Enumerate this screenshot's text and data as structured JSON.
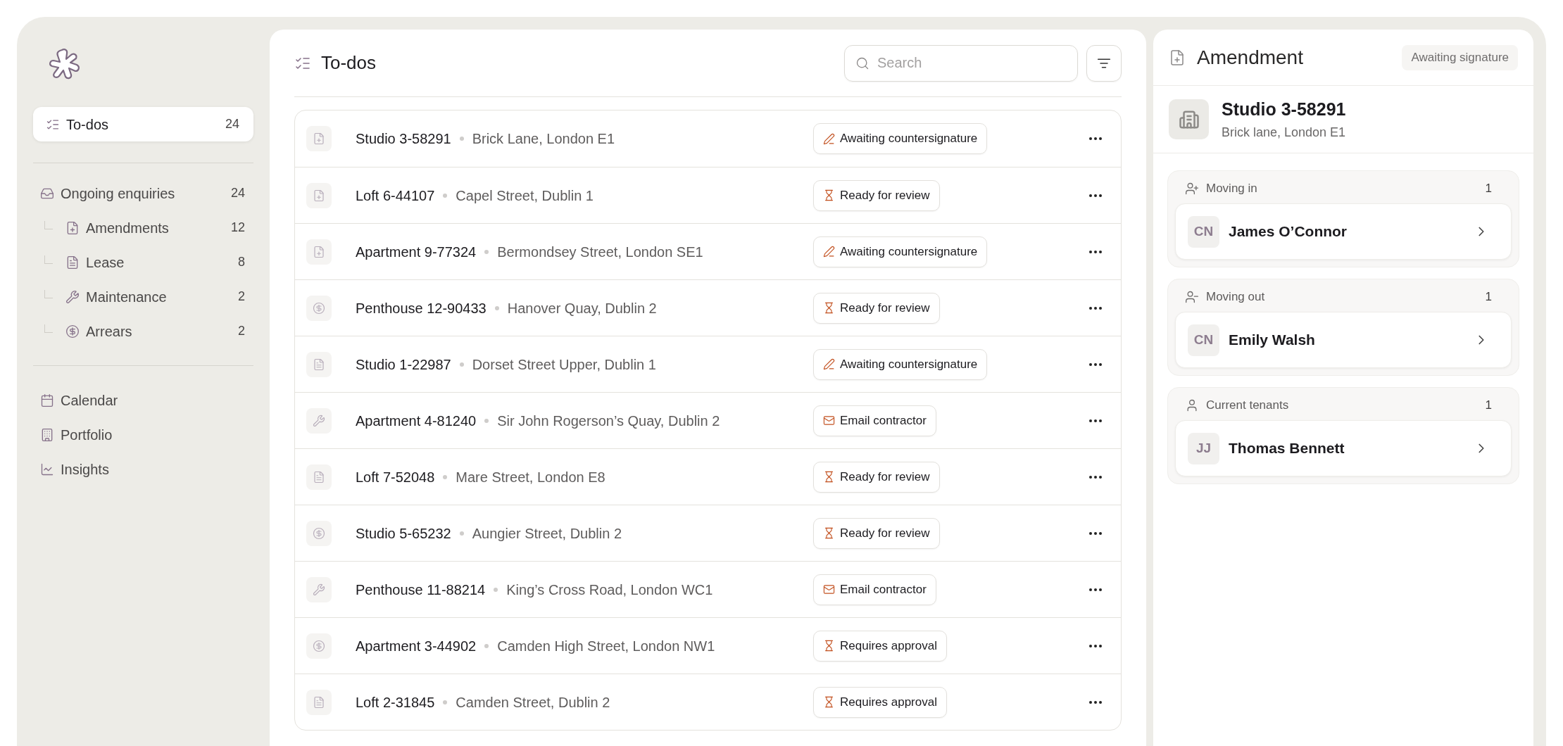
{
  "sidebar": {
    "items": [
      {
        "kind": "todos",
        "label": "To-dos",
        "count": "24",
        "selected": true
      },
      {
        "kind": "enquiries",
        "label": "Ongoing enquiries",
        "count": "24",
        "selected": false,
        "children": [
          {
            "kind": "amendment",
            "label": "Amendments",
            "count": "12",
            "selected": false
          },
          {
            "kind": "lease",
            "label": "Lease",
            "count": "8",
            "selected": false
          },
          {
            "kind": "maintenance",
            "label": "Maintenance",
            "count": "2",
            "selected": false
          },
          {
            "kind": "arrears",
            "label": "Arrears",
            "count": "2",
            "selected": false
          }
        ]
      },
      {
        "kind": "calendar",
        "label": "Calendar",
        "selected": false
      },
      {
        "kind": "portfolio",
        "label": "Portfolio",
        "selected": false
      },
      {
        "kind": "insights",
        "label": "Insights",
        "selected": false
      }
    ]
  },
  "main": {
    "title": "To-dos",
    "search": {
      "placeholder": "Search"
    },
    "rows": [
      {
        "kind": "amendment",
        "name": "Studio 3-58291",
        "address": "Brick Lane, London E1",
        "status": {
          "kind": "sign",
          "label": "Awaiting countersignature"
        }
      },
      {
        "kind": "amendment",
        "name": "Loft 6-44107",
        "address": "Capel Street, Dublin 1",
        "status": {
          "kind": "wait",
          "label": "Ready for review"
        }
      },
      {
        "kind": "amendment",
        "name": "Apartment 9-77324",
        "address": "Bermondsey Street, London SE1",
        "status": {
          "kind": "sign",
          "label": "Awaiting countersignature"
        }
      },
      {
        "kind": "arrears",
        "name": "Penthouse 12-90433",
        "address": "Hanover Quay, Dublin 2",
        "status": {
          "kind": "wait",
          "label": "Ready for review"
        }
      },
      {
        "kind": "lease",
        "name": "Studio 1-22987",
        "address": "Dorset Street Upper, Dublin 1",
        "status": {
          "kind": "sign",
          "label": "Awaiting countersignature"
        }
      },
      {
        "kind": "maintenance",
        "name": "Apartment 4-81240",
        "address": "Sir John Rogerson’s Quay, Dublin 2",
        "status": {
          "kind": "mail",
          "label": "Email contractor"
        }
      },
      {
        "kind": "lease",
        "name": "Loft 7-52048",
        "address": "Mare Street, London E8",
        "status": {
          "kind": "wait",
          "label": "Ready for review"
        }
      },
      {
        "kind": "arrears",
        "name": "Studio 5-65232",
        "address": "Aungier Street, Dublin 2",
        "status": {
          "kind": "wait",
          "label": "Ready for review"
        }
      },
      {
        "kind": "maintenance",
        "name": "Penthouse 11-88214",
        "address": "King’s Cross Road, London WC1",
        "status": {
          "kind": "mail",
          "label": "Email contractor"
        }
      },
      {
        "kind": "arrears",
        "name": "Apartment 3-44902",
        "address": "Camden High Street, London NW1",
        "status": {
          "kind": "wait",
          "label": "Requires approval"
        }
      },
      {
        "kind": "lease",
        "name": "Loft 2-31845",
        "address": "Camden Street, Dublin 2",
        "status": {
          "kind": "wait",
          "label": "Requires approval"
        }
      }
    ]
  },
  "detail": {
    "title": "Amendment",
    "badge": "Awaiting signature",
    "property": {
      "name": "Studio 3-58291",
      "address": "Brick lane, London E1"
    },
    "groups": [
      {
        "kind": "in",
        "label": "Moving in",
        "count": "1",
        "people": [
          {
            "initials": "CN",
            "name": "James O’Connor"
          }
        ]
      },
      {
        "kind": "out",
        "label": "Moving out",
        "count": "1",
        "people": [
          {
            "initials": "CN",
            "name": "Emily Walsh"
          }
        ]
      },
      {
        "kind": "current",
        "label": "Current tenants",
        "count": "1",
        "people": [
          {
            "initials": "JJ",
            "name": "Thomas Bennett"
          }
        ]
      }
    ]
  }
}
